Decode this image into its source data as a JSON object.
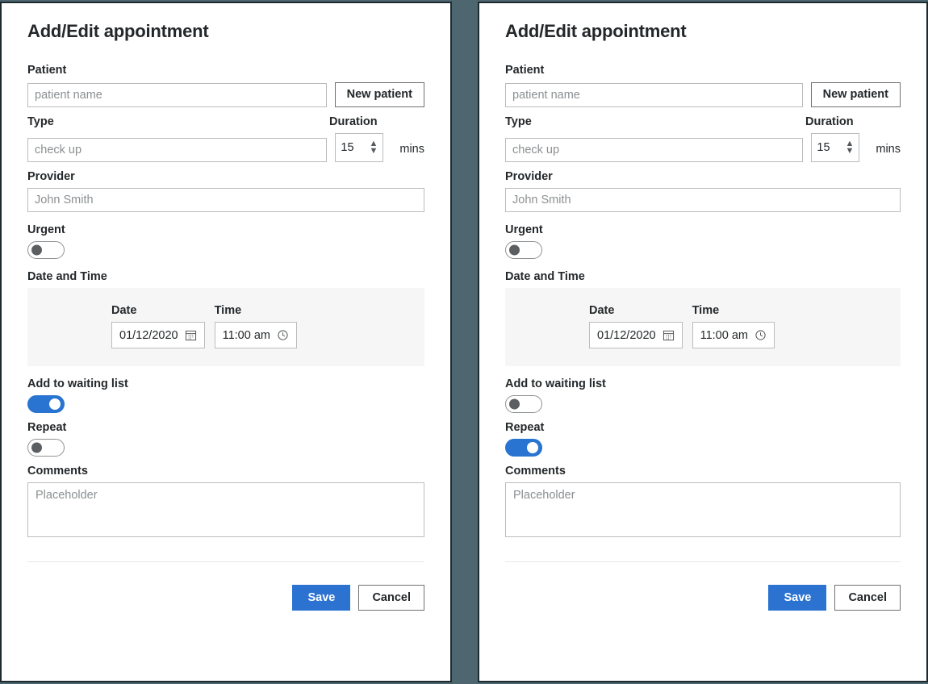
{
  "theme": {
    "backdrop": "#4e6670",
    "accent": "#2b72d1",
    "toggle_on": "#2874d0",
    "panel_bg": "#f6f6f6",
    "border": "#b9bcbe",
    "card_border": "#1d2b2f",
    "text": "#24282b",
    "placeholder": "#8b8f92"
  },
  "panels": [
    {
      "title": "Add/Edit appointment",
      "patient": {
        "label": "Patient",
        "placeholder": "patient name",
        "value": "",
        "new_patient_button": "New patient"
      },
      "type": {
        "label": "Type",
        "placeholder": "check up",
        "value": ""
      },
      "duration": {
        "label": "Duration",
        "value": "15",
        "unit": "mins",
        "increment_icon": "chevron-up-icon",
        "decrement_icon": "chevron-down-icon"
      },
      "provider": {
        "label": "Provider",
        "placeholder": "John Smith",
        "value": ""
      },
      "urgent": {
        "label": "Urgent",
        "state": "off"
      },
      "date_time": {
        "label": "Date and Time",
        "date_label": "Date",
        "date_value": "01/12/2020",
        "date_icon": "calendar-icon",
        "time_label": "Time",
        "time_value": "11:00 am",
        "time_icon": "clock-icon"
      },
      "waiting_list": {
        "label": "Add to waiting list",
        "state": "on"
      },
      "repeat": {
        "label": "Repeat",
        "state": "off"
      },
      "comments": {
        "label": "Comments",
        "placeholder": "Placeholder",
        "value": ""
      },
      "footer": {
        "save_label": "Save",
        "cancel_label": "Cancel"
      }
    },
    {
      "title": "Add/Edit appointment",
      "patient": {
        "label": "Patient",
        "placeholder": "patient name",
        "value": "",
        "new_patient_button": "New patient"
      },
      "type": {
        "label": "Type",
        "placeholder": "check up",
        "value": ""
      },
      "duration": {
        "label": "Duration",
        "value": "15",
        "unit": "mins",
        "increment_icon": "chevron-up-icon",
        "decrement_icon": "chevron-down-icon"
      },
      "provider": {
        "label": "Provider",
        "placeholder": "John Smith",
        "value": ""
      },
      "urgent": {
        "label": "Urgent",
        "state": "off"
      },
      "date_time": {
        "label": "Date and Time",
        "date_label": "Date",
        "date_value": "01/12/2020",
        "date_icon": "calendar-icon",
        "time_label": "Time",
        "time_value": "11:00 am",
        "time_icon": "clock-icon"
      },
      "waiting_list": {
        "label": "Add to waiting list",
        "state": "off"
      },
      "repeat": {
        "label": "Repeat",
        "state": "on"
      },
      "comments": {
        "label": "Comments",
        "placeholder": "Placeholder",
        "value": ""
      },
      "footer": {
        "save_label": "Save",
        "cancel_label": "Cancel"
      }
    }
  ]
}
